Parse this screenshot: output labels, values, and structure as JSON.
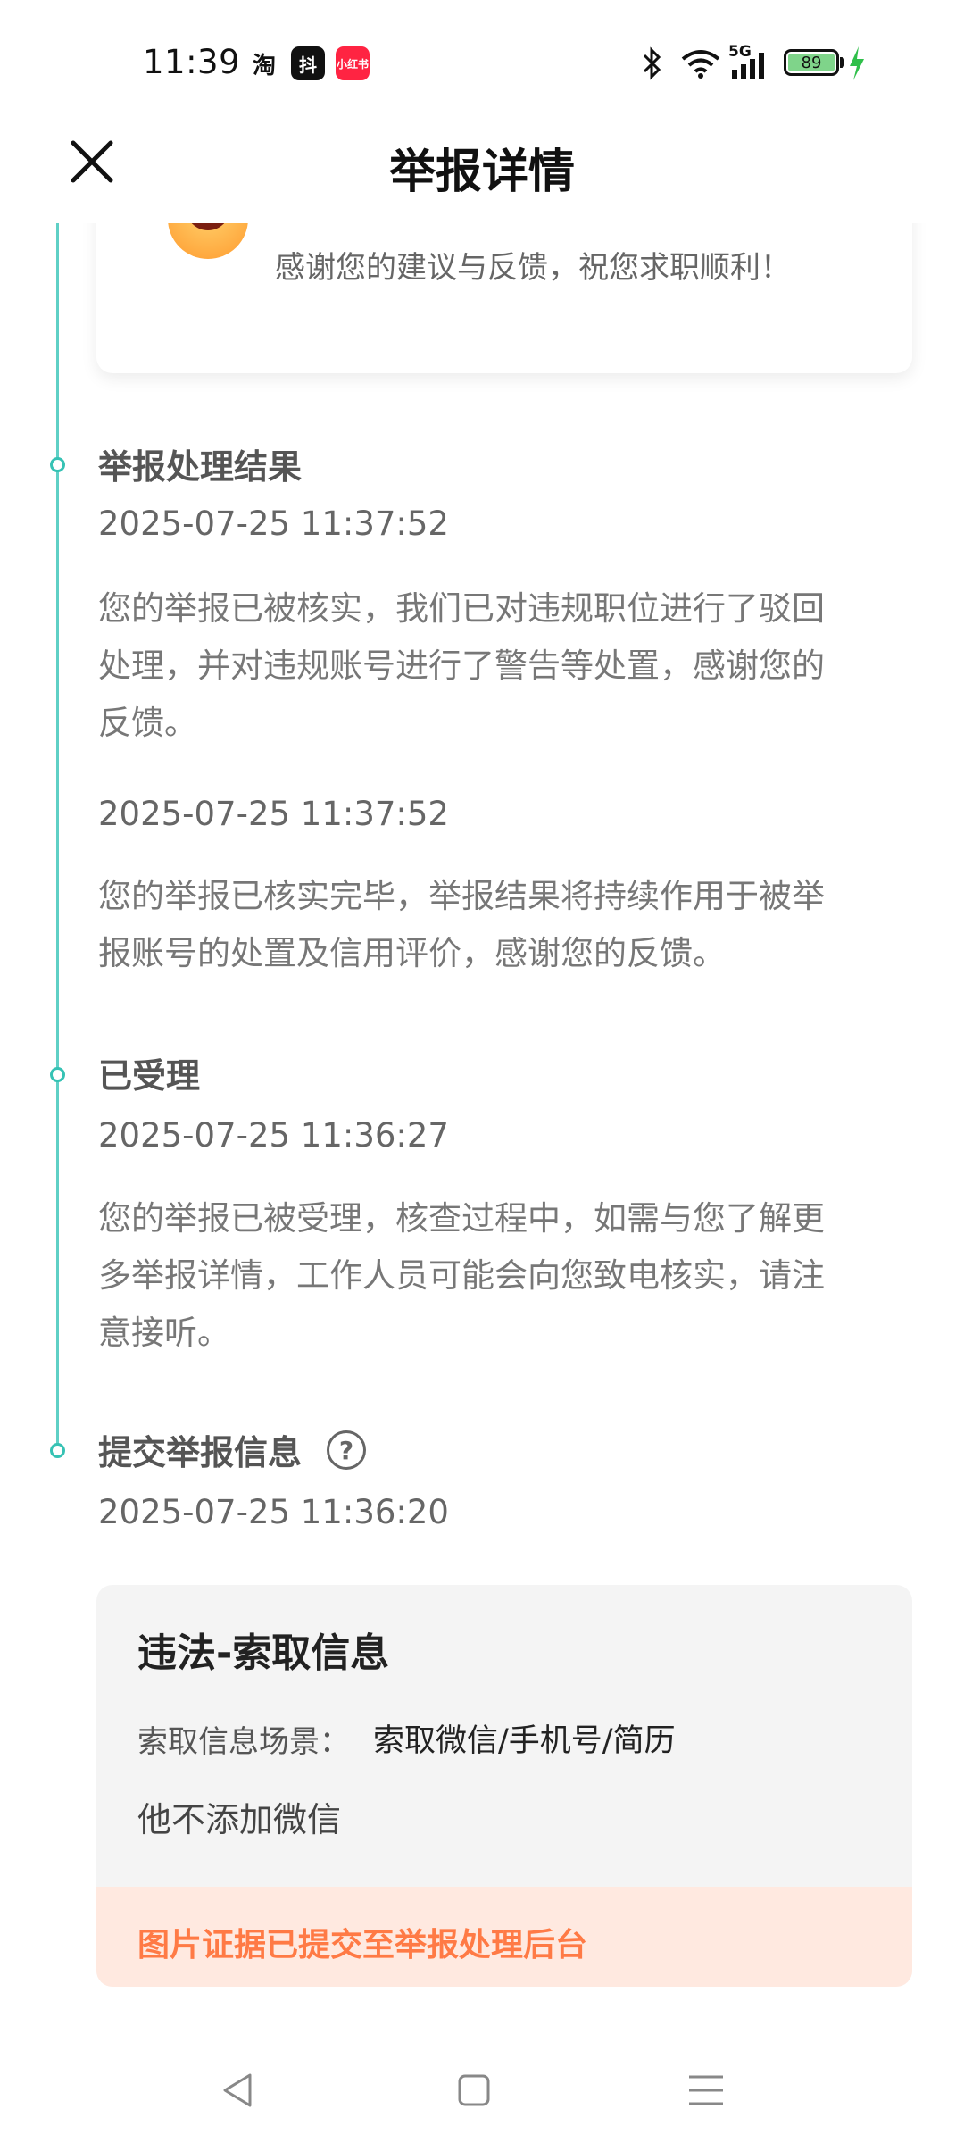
{
  "status_bar": {
    "time": "11:39",
    "apps": [
      "淘",
      "抖",
      "小红书"
    ],
    "network": "5G",
    "battery": "89",
    "icons": [
      "bluetooth-icon",
      "wifi-icon",
      "signal-icon",
      "battery-icon",
      "charging-icon"
    ]
  },
  "header": {
    "title": "举报详情",
    "close_icon": "close-icon"
  },
  "feedback_card": {
    "text": "感谢您的建议与反馈，祝您求职顺利！",
    "icon": "smile-emoji-icon"
  },
  "timeline": {
    "line_color": "#5fd0c6",
    "items": [
      {
        "title": "举报处理结果",
        "entries": [
          {
            "time": "2025-07-25 11:37:52",
            "lines": [
              "您的举报已被核实，我们已对违规职位进行了驳回",
              "处理，并对违规账号进行了警告等处置，感谢您的",
              "反馈。"
            ]
          },
          {
            "time": "2025-07-25 11:37:52",
            "lines": [
              "您的举报已核实完毕，举报结果将持续作用于被举",
              "报账号的处置及信用评价，感谢您的反馈。"
            ]
          }
        ]
      },
      {
        "title": "已受理",
        "entries": [
          {
            "time": "2025-07-25 11:36:27",
            "lines": [
              "您的举报已被受理，核查过程中，如需与您了解更",
              "多举报详情，工作人员可能会向您致电核实，请注",
              "意接听。"
            ]
          }
        ]
      },
      {
        "title": "提交举报信息",
        "help": "?",
        "entries": [
          {
            "time": "2025-07-25 11:36:20"
          }
        ]
      }
    ]
  },
  "report_info": {
    "title": "违法-索取信息",
    "label": "索取信息场景：",
    "value": "索取微信/手机号/简历",
    "note": "他不添加微信",
    "footer": "图片证据已提交至举报处理后台",
    "footer_color": "#ff7a45"
  },
  "nav_bar": {
    "buttons": [
      "back-icon",
      "home-icon",
      "menu-icon"
    ]
  }
}
